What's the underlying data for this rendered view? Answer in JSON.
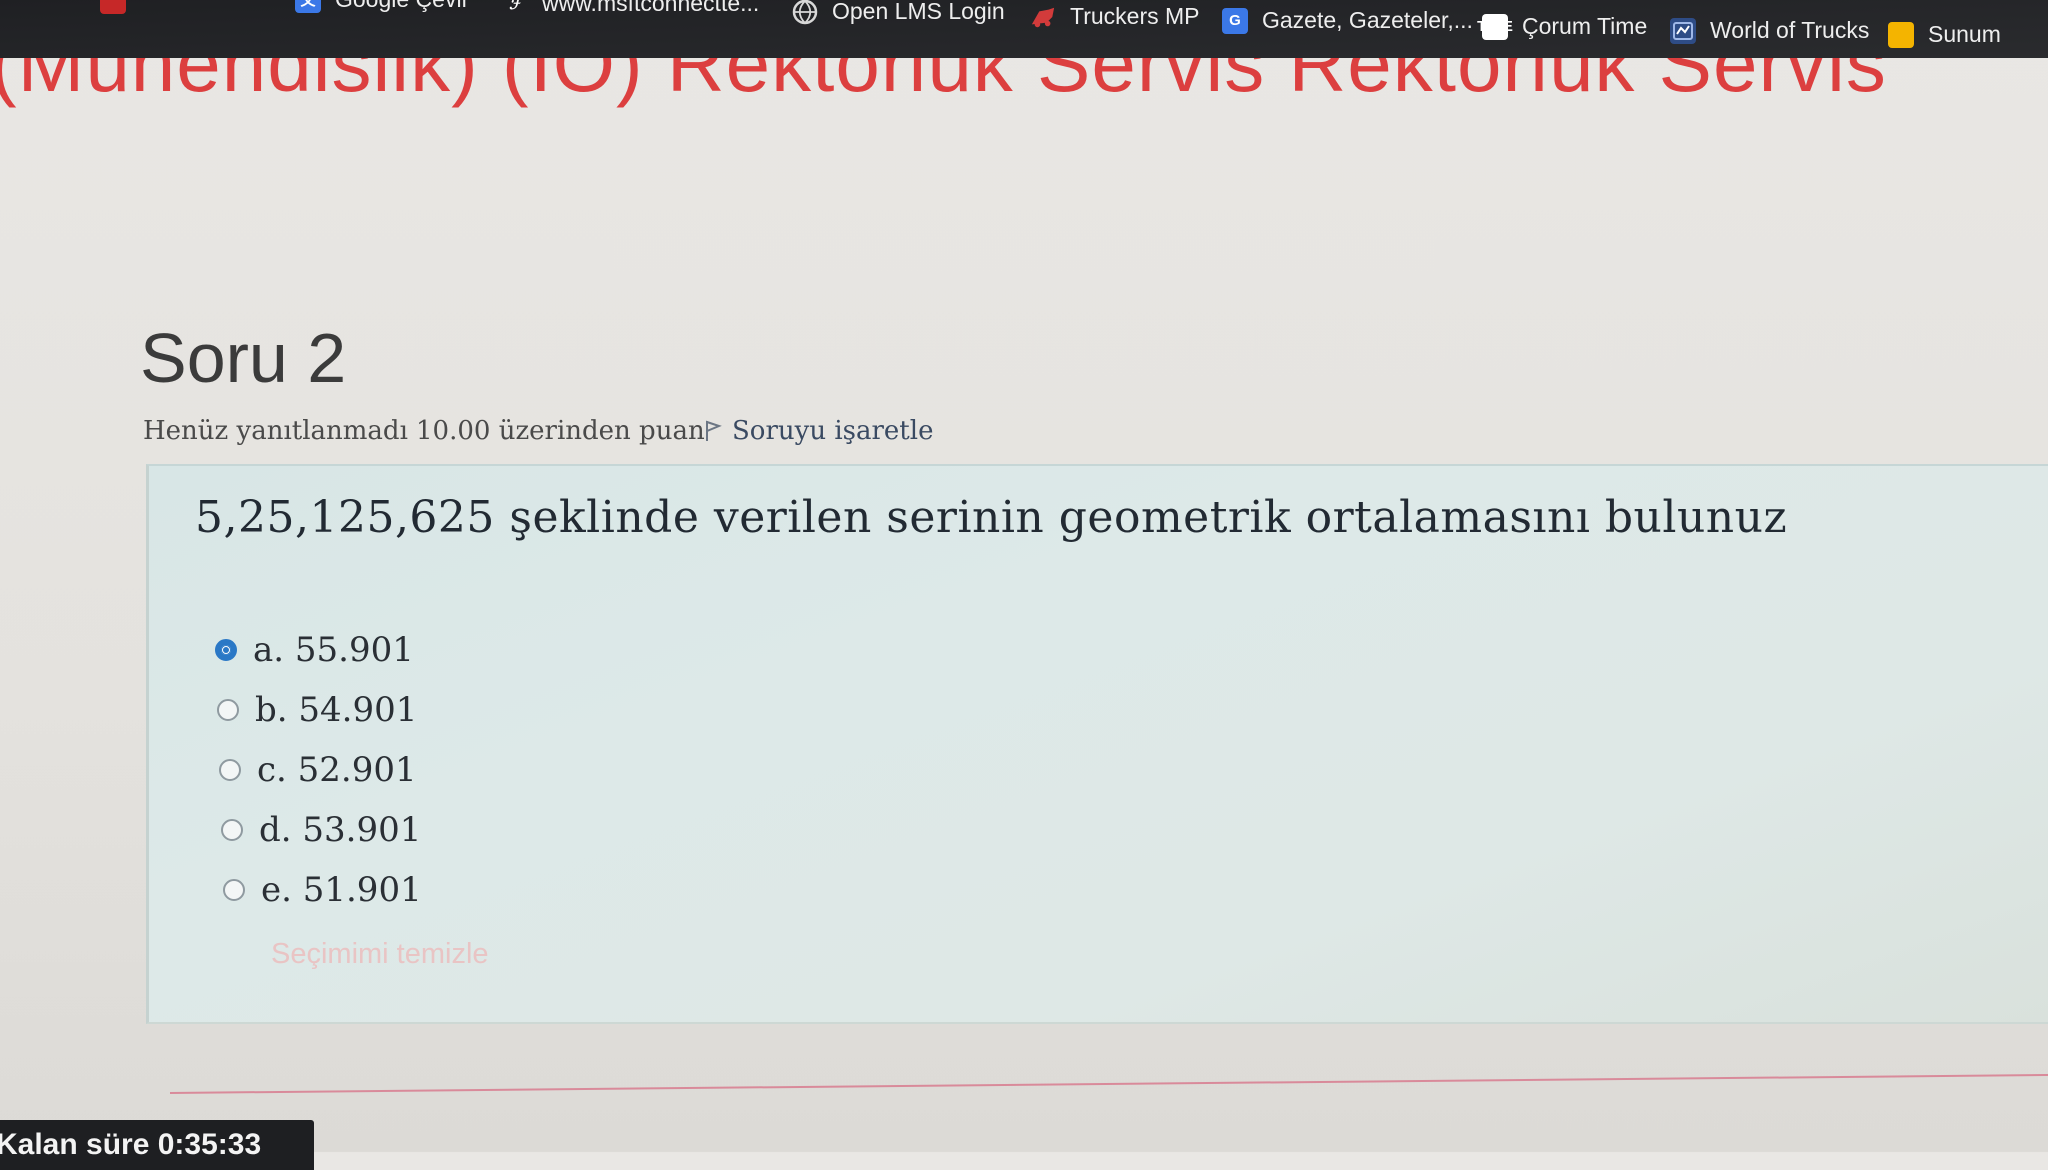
{
  "browser": {
    "bookmarks": [
      {
        "label": "",
        "icon": "red-square-icon"
      },
      {
        "label": "Google Çevir",
        "icon": "translate-icon"
      },
      {
        "label": "www.msftconnectte...",
        "icon": "msft-icon"
      },
      {
        "label": "Open LMS Login",
        "icon": "globe-icon"
      },
      {
        "label": "Truckers MP",
        "icon": "truck-icon"
      },
      {
        "label": "Gazete, Gazeteler,...",
        "icon": "g-icon",
        "icon_glyph": "G"
      },
      {
        "label": "Çorum Time",
        "icon": "time-icon",
        "icon_glyph": "TIME"
      },
      {
        "label": "World of Trucks",
        "icon": "world-of-trucks-icon"
      },
      {
        "label": "Sunum",
        "icon": "slides-icon"
      }
    ]
  },
  "course": {
    "title": "(Mühendislik) (İÖ) Rektörlük Servis Rektörlük Servis"
  },
  "question": {
    "number_label": "Soru 2",
    "status": "Henüz yanıtlanmadı",
    "grade": "10.00 üzerinden puan",
    "flag_label": "Soruyu işaretle",
    "text": "5,25,125,625 şeklinde verilen serinin geometrik ortalamasını bulunuz",
    "options": [
      {
        "label": "a. 55.901",
        "checked": true
      },
      {
        "label": "b. 54.901",
        "checked": false
      },
      {
        "label": "c. 52.901",
        "checked": false
      },
      {
        "label": "d. 53.901",
        "checked": false
      },
      {
        "label": "e. 51.901",
        "checked": false
      }
    ],
    "clear_label": "Seçimimi temizle"
  },
  "timer": {
    "label": "Kalan süre 0:35:33"
  },
  "colors": {
    "course_title": "#dc3f3f",
    "panel_bg": "#dde9e8",
    "radio_selected": "#2a78c6",
    "timer_bg": "#1e1f22"
  }
}
